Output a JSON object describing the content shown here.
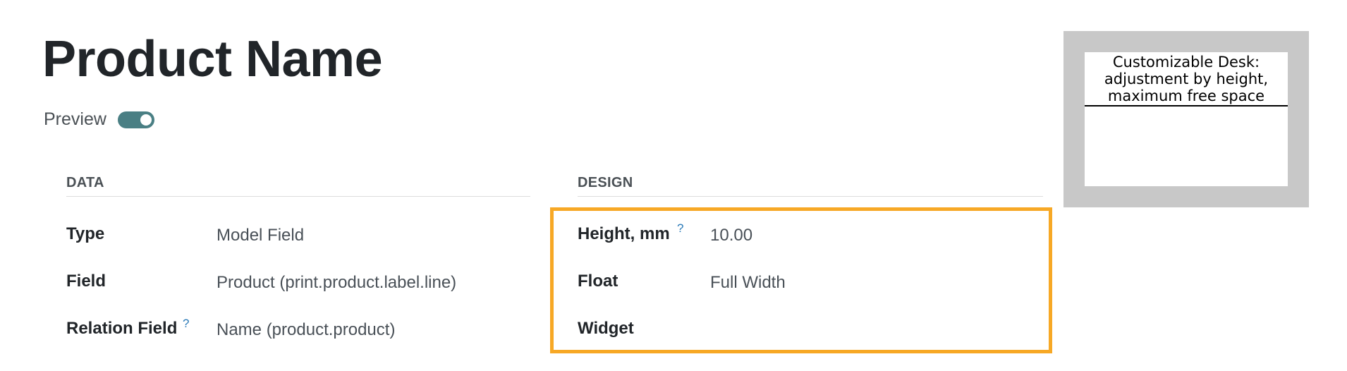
{
  "header": {
    "title": "Product Name",
    "preview_label": "Preview",
    "preview_on": true
  },
  "data_section": {
    "heading": "DATA",
    "rows": [
      {
        "label": "Type",
        "value": "Model Field",
        "help": ""
      },
      {
        "label": "Field",
        "value": "Product (print.product.label.line)",
        "help": ""
      },
      {
        "label": "Relation Field",
        "value": "Name (product.product)",
        "help": "?"
      }
    ]
  },
  "design_section": {
    "heading": "DESIGN",
    "rows": [
      {
        "label": "Height, mm",
        "value": "10.00",
        "help": "?"
      },
      {
        "label": "Float",
        "value": "Full Width",
        "help": ""
      },
      {
        "label": "Widget",
        "value": "",
        "help": ""
      }
    ]
  },
  "label_preview": {
    "text": "Customizable Desk: adjustment by height, maximum free space"
  },
  "colors": {
    "highlight": "#f7a825",
    "toggle": "#4a7f84",
    "help_link": "#2a7ab8"
  }
}
